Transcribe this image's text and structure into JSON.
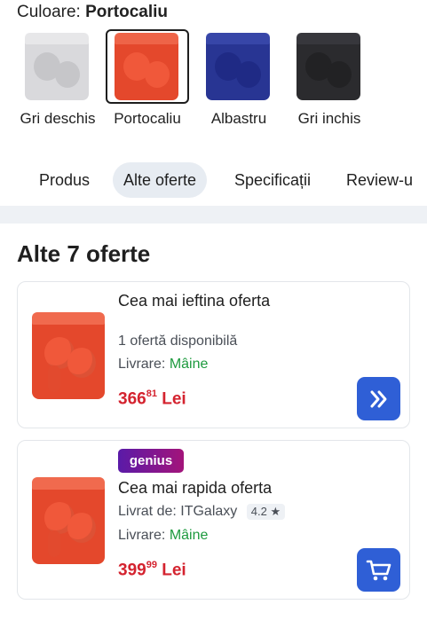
{
  "color_selector": {
    "label": "Culoare:",
    "selected_value": "Portocaliu",
    "options": [
      {
        "name": "Gri deschis",
        "case_color": "#d9d9dc",
        "bud_color": "#c6c6c9"
      },
      {
        "name": "Portocaliu",
        "case_color": "#e4482c",
        "bud_color": "#f0583a"
      },
      {
        "name": "Albastru",
        "case_color": "#283593",
        "bud_color": "#1f2a85"
      },
      {
        "name": "Gri inchis",
        "case_color": "#2b2b2e",
        "bud_color": "#222224"
      }
    ]
  },
  "tabs": [
    "Produs",
    "Alte oferte",
    "Specificații",
    "Review-u"
  ],
  "active_tab": "Alte oferte",
  "section": {
    "title": "Alte 7 oferte"
  },
  "offers": [
    {
      "title": "Cea mai ieftina oferta",
      "sub": "1 ofertă disponibilă",
      "delivery_label": "Livrare:",
      "delivery_value": "Mâine",
      "price_int": "366",
      "price_dec": "81",
      "currency": "Lei",
      "action_icon": "double-chevron-right-icon"
    },
    {
      "badge": "genius",
      "title": "Cea mai rapida oferta",
      "seller_label": "Livrat de:",
      "seller": "ITGalaxy",
      "rating": "4.2",
      "delivery_label": "Livrare:",
      "delivery_value": "Mâine",
      "price_int": "399",
      "price_dec": "99",
      "currency": "Lei",
      "action_icon": "cart-icon"
    }
  ],
  "colors": {
    "accent": "#2f5fd6",
    "price": "#d4232f",
    "delivery": "#1d9a3e"
  }
}
